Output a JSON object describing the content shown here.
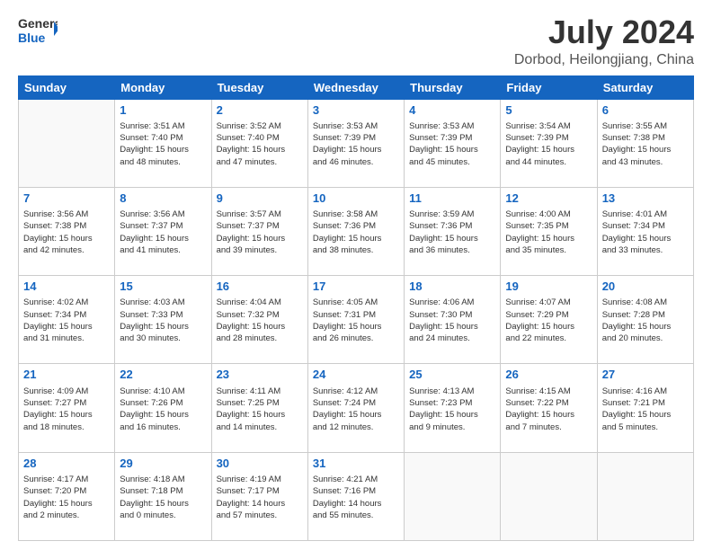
{
  "logo": {
    "text_general": "General",
    "text_blue": "Blue"
  },
  "header": {
    "month_year": "July 2024",
    "location": "Dorbod, Heilongjiang, China"
  },
  "weekdays": [
    "Sunday",
    "Monday",
    "Tuesday",
    "Wednesday",
    "Thursday",
    "Friday",
    "Saturday"
  ],
  "weeks": [
    [
      {
        "day": "",
        "info": ""
      },
      {
        "day": "1",
        "info": "Sunrise: 3:51 AM\nSunset: 7:40 PM\nDaylight: 15 hours\nand 48 minutes."
      },
      {
        "day": "2",
        "info": "Sunrise: 3:52 AM\nSunset: 7:40 PM\nDaylight: 15 hours\nand 47 minutes."
      },
      {
        "day": "3",
        "info": "Sunrise: 3:53 AM\nSunset: 7:39 PM\nDaylight: 15 hours\nand 46 minutes."
      },
      {
        "day": "4",
        "info": "Sunrise: 3:53 AM\nSunset: 7:39 PM\nDaylight: 15 hours\nand 45 minutes."
      },
      {
        "day": "5",
        "info": "Sunrise: 3:54 AM\nSunset: 7:39 PM\nDaylight: 15 hours\nand 44 minutes."
      },
      {
        "day": "6",
        "info": "Sunrise: 3:55 AM\nSunset: 7:38 PM\nDaylight: 15 hours\nand 43 minutes."
      }
    ],
    [
      {
        "day": "7",
        "info": "Sunrise: 3:56 AM\nSunset: 7:38 PM\nDaylight: 15 hours\nand 42 minutes."
      },
      {
        "day": "8",
        "info": "Sunrise: 3:56 AM\nSunset: 7:37 PM\nDaylight: 15 hours\nand 41 minutes."
      },
      {
        "day": "9",
        "info": "Sunrise: 3:57 AM\nSunset: 7:37 PM\nDaylight: 15 hours\nand 39 minutes."
      },
      {
        "day": "10",
        "info": "Sunrise: 3:58 AM\nSunset: 7:36 PM\nDaylight: 15 hours\nand 38 minutes."
      },
      {
        "day": "11",
        "info": "Sunrise: 3:59 AM\nSunset: 7:36 PM\nDaylight: 15 hours\nand 36 minutes."
      },
      {
        "day": "12",
        "info": "Sunrise: 4:00 AM\nSunset: 7:35 PM\nDaylight: 15 hours\nand 35 minutes."
      },
      {
        "day": "13",
        "info": "Sunrise: 4:01 AM\nSunset: 7:34 PM\nDaylight: 15 hours\nand 33 minutes."
      }
    ],
    [
      {
        "day": "14",
        "info": "Sunrise: 4:02 AM\nSunset: 7:34 PM\nDaylight: 15 hours\nand 31 minutes."
      },
      {
        "day": "15",
        "info": "Sunrise: 4:03 AM\nSunset: 7:33 PM\nDaylight: 15 hours\nand 30 minutes."
      },
      {
        "day": "16",
        "info": "Sunrise: 4:04 AM\nSunset: 7:32 PM\nDaylight: 15 hours\nand 28 minutes."
      },
      {
        "day": "17",
        "info": "Sunrise: 4:05 AM\nSunset: 7:31 PM\nDaylight: 15 hours\nand 26 minutes."
      },
      {
        "day": "18",
        "info": "Sunrise: 4:06 AM\nSunset: 7:30 PM\nDaylight: 15 hours\nand 24 minutes."
      },
      {
        "day": "19",
        "info": "Sunrise: 4:07 AM\nSunset: 7:29 PM\nDaylight: 15 hours\nand 22 minutes."
      },
      {
        "day": "20",
        "info": "Sunrise: 4:08 AM\nSunset: 7:28 PM\nDaylight: 15 hours\nand 20 minutes."
      }
    ],
    [
      {
        "day": "21",
        "info": "Sunrise: 4:09 AM\nSunset: 7:27 PM\nDaylight: 15 hours\nand 18 minutes."
      },
      {
        "day": "22",
        "info": "Sunrise: 4:10 AM\nSunset: 7:26 PM\nDaylight: 15 hours\nand 16 minutes."
      },
      {
        "day": "23",
        "info": "Sunrise: 4:11 AM\nSunset: 7:25 PM\nDaylight: 15 hours\nand 14 minutes."
      },
      {
        "day": "24",
        "info": "Sunrise: 4:12 AM\nSunset: 7:24 PM\nDaylight: 15 hours\nand 12 minutes."
      },
      {
        "day": "25",
        "info": "Sunrise: 4:13 AM\nSunset: 7:23 PM\nDaylight: 15 hours\nand 9 minutes."
      },
      {
        "day": "26",
        "info": "Sunrise: 4:15 AM\nSunset: 7:22 PM\nDaylight: 15 hours\nand 7 minutes."
      },
      {
        "day": "27",
        "info": "Sunrise: 4:16 AM\nSunset: 7:21 PM\nDaylight: 15 hours\nand 5 minutes."
      }
    ],
    [
      {
        "day": "28",
        "info": "Sunrise: 4:17 AM\nSunset: 7:20 PM\nDaylight: 15 hours\nand 2 minutes."
      },
      {
        "day": "29",
        "info": "Sunrise: 4:18 AM\nSunset: 7:18 PM\nDaylight: 15 hours\nand 0 minutes."
      },
      {
        "day": "30",
        "info": "Sunrise: 4:19 AM\nSunset: 7:17 PM\nDaylight: 14 hours\nand 57 minutes."
      },
      {
        "day": "31",
        "info": "Sunrise: 4:21 AM\nSunset: 7:16 PM\nDaylight: 14 hours\nand 55 minutes."
      },
      {
        "day": "",
        "info": ""
      },
      {
        "day": "",
        "info": ""
      },
      {
        "day": "",
        "info": ""
      }
    ]
  ]
}
